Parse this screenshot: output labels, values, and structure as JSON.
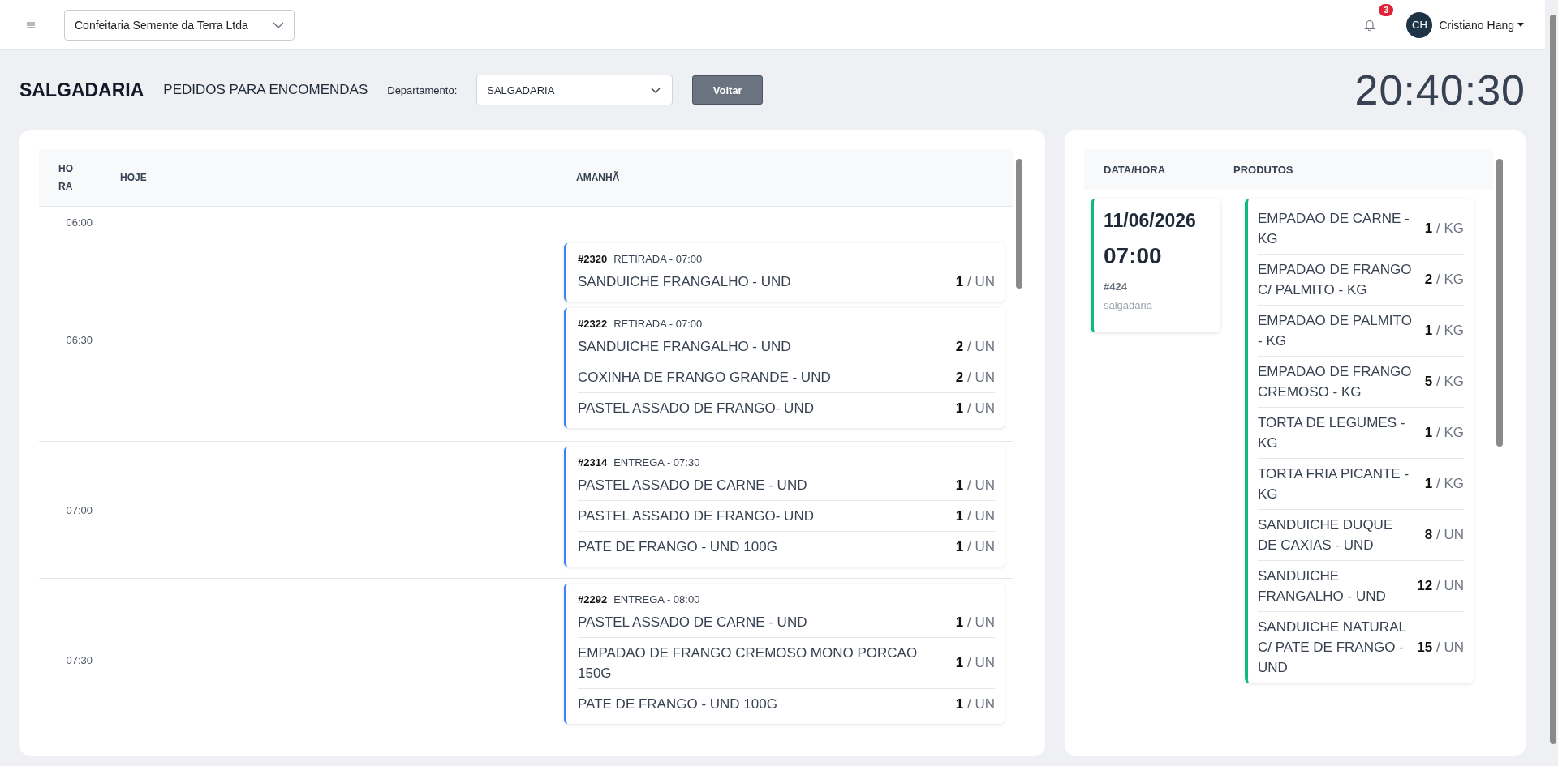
{
  "topbar": {
    "company": "Confeitaria Semente da Terra Ltda",
    "notification_count": "3",
    "user_initials": "CH",
    "user_name": "Cristiano Hang"
  },
  "header": {
    "title": "SALGADARIA",
    "subtitle": "PEDIDOS PARA ENCOMENDAS",
    "department_label": "Departamento:",
    "department_value": "SALGADARIA",
    "back_button": "Voltar",
    "clock": "20:40:30"
  },
  "schedule": {
    "columns": [
      "HORA",
      "HOJE",
      "AMANHÃ"
    ],
    "rows": [
      {
        "time": "06:00",
        "today": [],
        "tomorrow": []
      },
      {
        "time": "06:30",
        "today": [],
        "tomorrow": [
          {
            "number": "#2320",
            "type": "RETIRADA - 07:00",
            "items": [
              {
                "name": "SANDUICHE FRANGALHO - UND",
                "qty": "1",
                "unit": "/ UN"
              }
            ]
          },
          {
            "number": "#2322",
            "type": "RETIRADA - 07:00",
            "items": [
              {
                "name": "SANDUICHE FRANGALHO - UND",
                "qty": "2",
                "unit": "/ UN"
              },
              {
                "name": "COXINHA DE FRANGO GRANDE - UND",
                "qty": "2",
                "unit": "/ UN"
              },
              {
                "name": "PASTEL ASSADO DE FRANGO- UND",
                "qty": "1",
                "unit": "/ UN"
              }
            ]
          }
        ]
      },
      {
        "time": "07:00",
        "today": [],
        "tomorrow": [
          {
            "number": "#2314",
            "type": "ENTREGA - 07:30",
            "items": [
              {
                "name": "PASTEL ASSADO DE CARNE - UND",
                "qty": "1",
                "unit": "/ UN"
              },
              {
                "name": "PASTEL ASSADO DE FRANGO- UND",
                "qty": "1",
                "unit": "/ UN"
              },
              {
                "name": "PATE DE FRANGO - UND 100G",
                "qty": "1",
                "unit": "/ UN"
              }
            ]
          }
        ]
      },
      {
        "time": "07:30",
        "today": [],
        "tomorrow": [
          {
            "number": "#2292",
            "type": "ENTREGA - 08:00",
            "items": [
              {
                "name": "PASTEL ASSADO DE CARNE - UND",
                "qty": "1",
                "unit": "/ UN"
              },
              {
                "name": "EMPADAO DE FRANGO CREMOSO MONO PORCAO 150G",
                "qty": "1",
                "unit": "/ UN"
              },
              {
                "name": "PATE DE FRANGO - UND 100G",
                "qty": "1",
                "unit": "/ UN"
              }
            ]
          }
        ]
      }
    ]
  },
  "orders": {
    "columns": [
      "DATA/HORA",
      "PRODUTOS"
    ],
    "entries": [
      {
        "date": "11/06/2026",
        "time": "07:00",
        "number": "#424",
        "department": "salgadaria",
        "products": [
          {
            "name": "EMPADAO DE CARNE - KG",
            "qty": "1",
            "unit": "/ KG"
          },
          {
            "name": "EMPADAO DE FRANGO C/ PALMITO - KG",
            "qty": "2",
            "unit": "/ KG"
          },
          {
            "name": "EMPADAO DE PALMITO - KG",
            "qty": "1",
            "unit": "/ KG"
          },
          {
            "name": "EMPADAO DE FRANGO CREMOSO - KG",
            "qty": "5",
            "unit": "/ KG"
          },
          {
            "name": "TORTA DE LEGUMES - KG",
            "qty": "1",
            "unit": "/ KG"
          },
          {
            "name": "TORTA FRIA PICANTE - KG",
            "qty": "1",
            "unit": "/ KG"
          },
          {
            "name": "SANDUICHE DUQUE DE CAXIAS - UND",
            "qty": "8",
            "unit": "/ UN"
          },
          {
            "name": "SANDUICHE FRANGALHO - UND",
            "qty": "12",
            "unit": "/ UN"
          },
          {
            "name": "SANDUICHE NATURAL C/ PATE DE FRANGO - UND",
            "qty": "15",
            "unit": "/ UN"
          }
        ]
      }
    ]
  }
}
